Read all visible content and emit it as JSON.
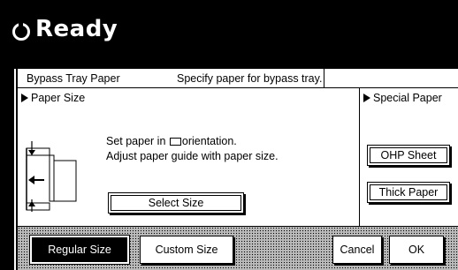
{
  "header": {
    "title": "Ready"
  },
  "panel": {
    "heading": "Bypass Tray Paper",
    "description": "Specify paper for bypass tray.",
    "paper_size_title": "Paper Size",
    "instruction_line1_prefix": "Set paper in",
    "instruction_line1_suffix": "orientation.",
    "instruction_line2": "Adjust paper guide with paper size.",
    "select_size_label": "Select Size",
    "special_paper_title": "Special Paper",
    "ohp_sheet_label": "OHP Sheet",
    "thick_paper_label": "Thick Paper"
  },
  "footer": {
    "regular_size_label": "Regular Size",
    "custom_size_label": "Custom Size",
    "cancel_label": "Cancel",
    "ok_label": "OK"
  }
}
